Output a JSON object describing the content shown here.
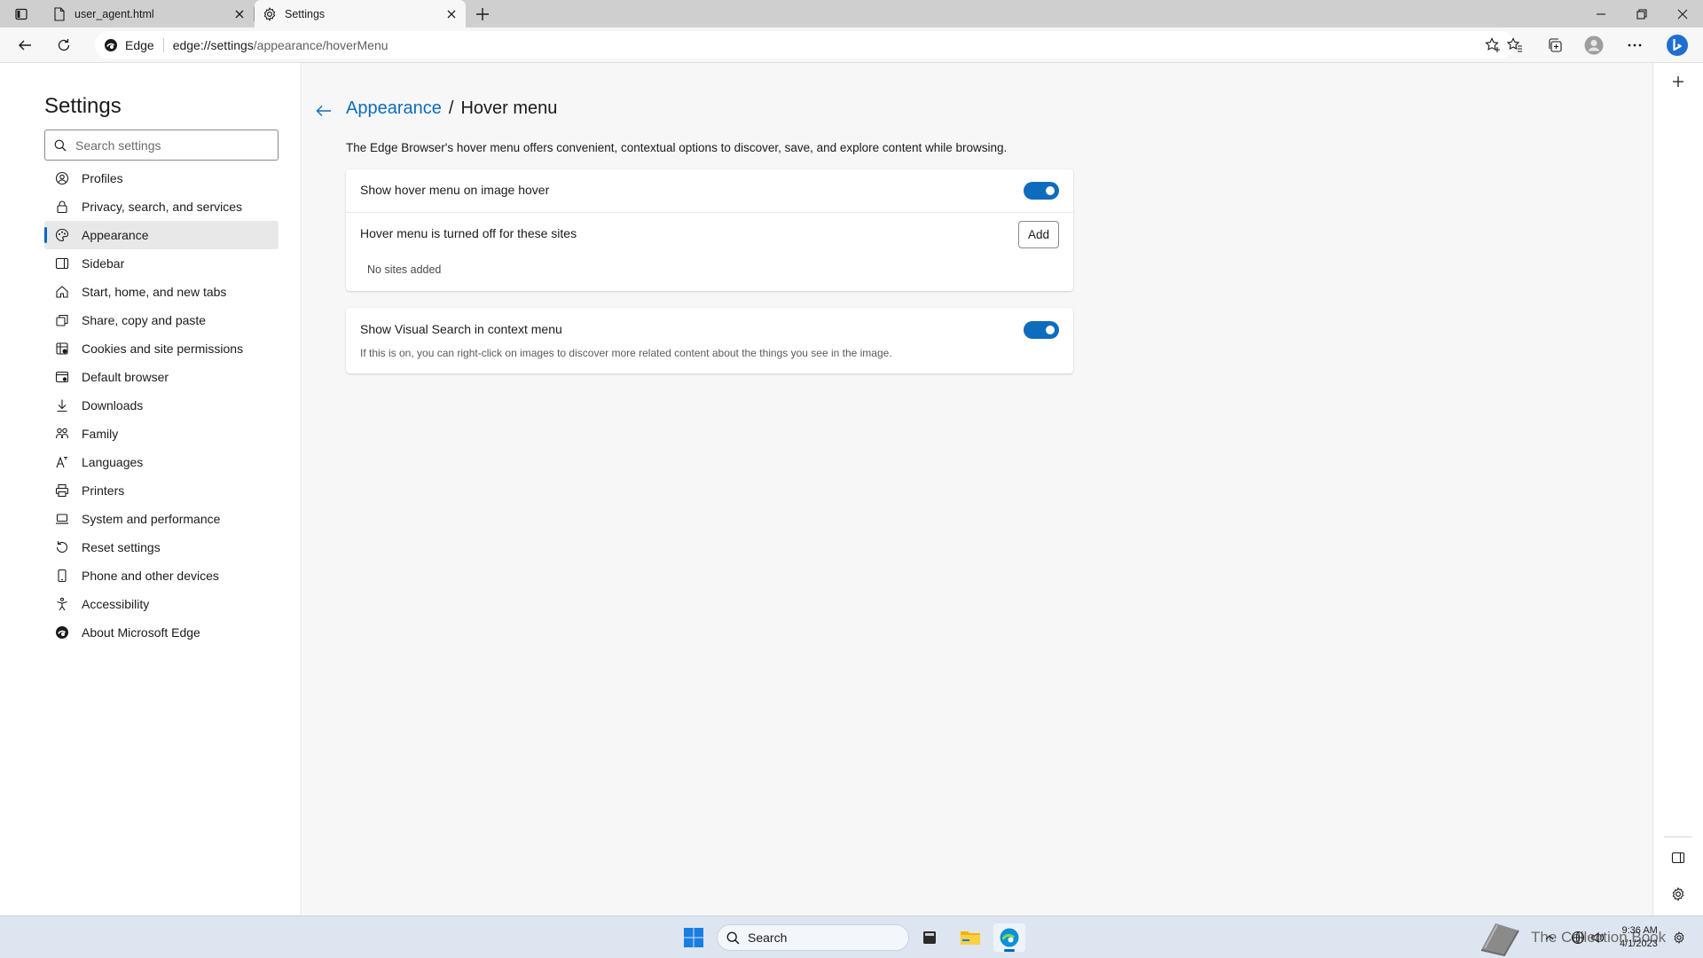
{
  "browser": {
    "tabs": [
      {
        "title": "user_agent.html",
        "icon": "document-icon",
        "active": false
      },
      {
        "title": "Settings",
        "icon": "gear-icon",
        "active": true
      }
    ],
    "address": {
      "site_label": "Edge",
      "url_host": "edge://settings",
      "url_path": "/appearance/hoverMenu"
    }
  },
  "settings_nav": {
    "title": "Settings",
    "search_placeholder": "Search settings",
    "items": [
      {
        "label": "Profiles",
        "icon": "profile-icon"
      },
      {
        "label": "Privacy, search, and services",
        "icon": "lock-icon"
      },
      {
        "label": "Appearance",
        "icon": "palette-icon",
        "active": true
      },
      {
        "label": "Sidebar",
        "icon": "sidebar-icon"
      },
      {
        "label": "Start, home, and new tabs",
        "icon": "home-icon"
      },
      {
        "label": "Share, copy and paste",
        "icon": "share-icon"
      },
      {
        "label": "Cookies and site permissions",
        "icon": "cookie-icon"
      },
      {
        "label": "Default browser",
        "icon": "browser-icon"
      },
      {
        "label": "Downloads",
        "icon": "download-icon"
      },
      {
        "label": "Family",
        "icon": "family-icon"
      },
      {
        "label": "Languages",
        "icon": "language-icon"
      },
      {
        "label": "Printers",
        "icon": "printer-icon"
      },
      {
        "label": "System and performance",
        "icon": "laptop-icon"
      },
      {
        "label": "Reset settings",
        "icon": "reset-icon"
      },
      {
        "label": "Phone and other devices",
        "icon": "phone-icon"
      },
      {
        "label": "Accessibility",
        "icon": "accessibility-icon"
      },
      {
        "label": "About Microsoft Edge",
        "icon": "edge-logo-icon"
      }
    ]
  },
  "page": {
    "breadcrumb_parent": "Appearance",
    "breadcrumb_separator": "/",
    "breadcrumb_current": "Hover menu",
    "description": "The Edge Browser's hover menu offers convenient, contextual options to discover, save, and explore content while browsing.",
    "hover_setting": {
      "label": "Show hover menu on image hover",
      "enabled": true
    },
    "blocked_sites": {
      "label": "Hover menu is turned off for these sites",
      "add_button": "Add",
      "empty_text": "No sites added"
    },
    "visual_search": {
      "label": "Show Visual Search in context menu",
      "description": "If this is on, you can right-click on images to discover more related content about the things you see in the image.",
      "enabled": true
    }
  },
  "taskbar": {
    "search_label": "Search",
    "apps": [
      "start-icon",
      "file-manager-icon",
      "folder-icon",
      "edge-icon"
    ],
    "clock_time": "9:36 AM",
    "clock_date": "4/1/2023",
    "watermark_text": "The Collection Book"
  },
  "colors": {
    "accent": "#0f6cbd",
    "nav_active_bg": "#e8e8e8",
    "tabstrip": "#cfcfcf",
    "content_bg": "#f7f7f7"
  }
}
